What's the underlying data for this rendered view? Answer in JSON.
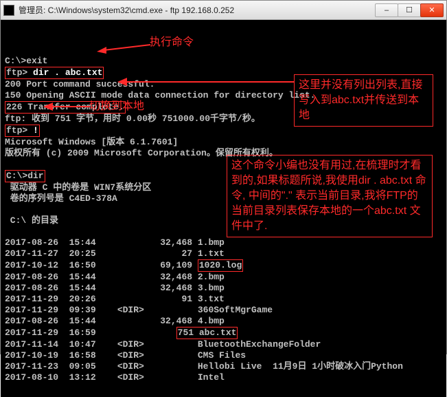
{
  "titlebar": {
    "icon_label": "cmd",
    "title": "管理员: C:\\Windows\\system32\\cmd.exe - ftp  192.168.0.252",
    "min_icon": "–",
    "max_icon": "☐",
    "close_icon": "✕"
  },
  "term": {
    "l1": "C:\\>exit",
    "l2_pre": "ftp> ",
    "l2_cmd": "dir . abc.txt",
    "l3": "200 Port command successful.",
    "l4": "150 Opening ASCII mode data connection for directory list.",
    "l5": "226 Transfer complete.",
    "l6": "ftp: 收到 751 字节，用时 0.00秒 751000.00千字节/秒。",
    "l7_pre": "ftp> ",
    "l7_cmd": "!",
    "l8": "Microsoft Windows [版本 6.1.7601]",
    "l9": "版权所有 (c) 2009 Microsoft Corporation。保留所有权利。",
    "l11": "C:\\>dir",
    "l12": " 驱动器 C 中的卷是 WIN7系统分区",
    "l13": " 卷的序列号是 C4ED-378A",
    "l15": " C:\\ 的目录"
  },
  "dir": {
    "r1": "2017-08-26  15:44            32,468 1.bmp",
    "r2": "2017-11-27  20:25                27 1.txt",
    "r3a": "2017-10-12  16:50            69,109 ",
    "r3b": "1020.log",
    "r4": "2017-08-26  15:44            32,468 2.bmp",
    "r5": "2017-08-26  15:44            32,468 3.bmp",
    "r6": "2017-11-29  20:26                91 3.txt",
    "r7": "2017-11-29  09:39    <DIR>          360SoftMgrGame",
    "r8": "2017-08-26  15:44            32,468 4.bmp",
    "r9a": "2017-11-29  16:59               ",
    "r9b": "751 abc.txt",
    "r10": "2017-11-14  10:47    <DIR>          BluetoothExchangeFolder",
    "r11": "2017-10-19  16:58    <DIR>          CMS Files",
    "r12": "2017-11-23  09:05    <DIR>          Hellobi Live  11月9日 1小时破冰入门Python",
    "r13": "2017-08-10  13:12    <DIR>          Intel"
  },
  "annotations": {
    "a1": "执行命令",
    "a2": "切换到本地",
    "a3": "这里并没有列出列表,直接写入到abc.txt并传送到本地",
    "a4": "这个命令小编也没有用过,在梳理时才看到的,如果标题所说,我使用dir . abc.txt 命令, 中间的\".\" 表示当前目录,我将FTP的当前目录列表保存本地的一个abc.txt 文件中了."
  }
}
